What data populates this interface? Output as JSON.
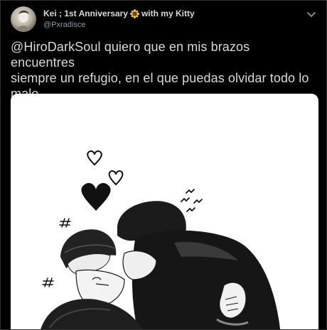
{
  "user": {
    "display_name_prefix": "Kei ; 1st Anniversary",
    "display_name_suffix": "with my Kitty",
    "handle": "@Pxradisce",
    "avatar_icon": "profile-photo"
  },
  "tweet": {
    "text": "@HiroDarkSoul quiero que en mis brazos encuentres\nsiempre un refugio, en el que puedas olvidar todo lo\nmalo.",
    "media_alt": "ilustración en blanco y negro de un abrazo"
  },
  "icons": {
    "caret": "chevron-down-icon",
    "emoji": "sunflower-icon"
  },
  "colors": {
    "background": "#000000",
    "text": "#d9d9d9",
    "secondary_text": "#8899a6",
    "media_background": "#ffffff"
  }
}
